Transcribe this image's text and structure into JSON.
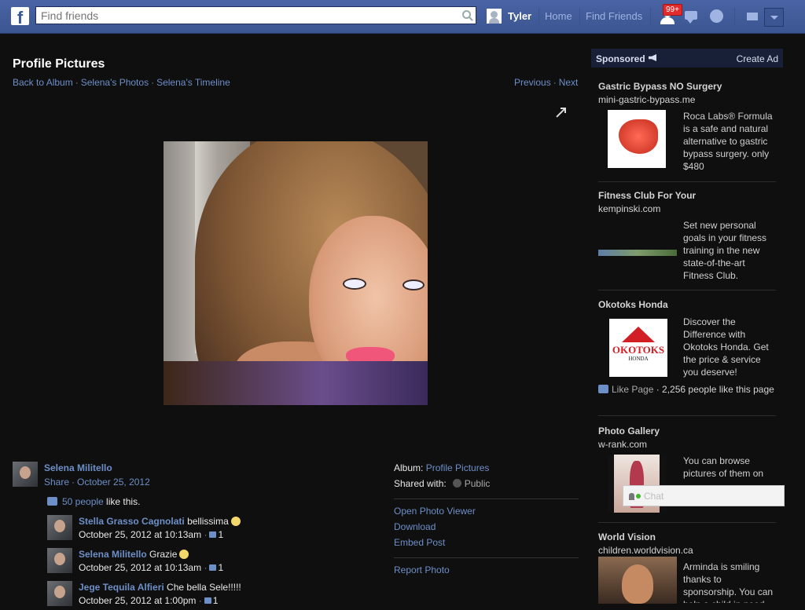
{
  "topbar": {
    "logo": "f",
    "search_placeholder": "Find friends",
    "user_name": "Tyler",
    "home": "Home",
    "find_friends": "Find Friends",
    "friend_requests_badge": "99+",
    "icons": [
      "search-icon",
      "friend-requests-icon",
      "messages-icon",
      "notifications-globe-icon",
      "privacy-shortcuts-icon",
      "account-menu-arrow-icon"
    ]
  },
  "page": {
    "title": "Profile Pictures",
    "breadcrumbs": [
      "Back to Album",
      "Selena's Photos",
      "Selena's Timeline"
    ],
    "previous": "Previous",
    "next": "Next"
  },
  "owner": {
    "name": "Selena Militello",
    "share": "Share",
    "date": "October 25, 2012"
  },
  "likes": {
    "count_link": "50 people",
    "suffix": " like this."
  },
  "comments": [
    {
      "name": "Stella Grasso Cagnolati",
      "text": "bellissima",
      "smiley": true,
      "time": "October 25, 2012 at 10:13am",
      "likes": "1"
    },
    {
      "name": "Selena Militello",
      "text": "Grazie",
      "smiley": true,
      "time": "October 25, 2012 at 10:13am",
      "likes": "1"
    },
    {
      "name": "Jege Tequila Alfieri",
      "text": "Che bella Sele!!!!!",
      "smiley": false,
      "time": "October 25, 2012 at 1:00pm",
      "likes": "1"
    }
  ],
  "details": {
    "album_label": "Album:",
    "album_value": "Profile Pictures",
    "shared_label": "Shared with:",
    "shared_value": "Public",
    "actions": [
      "Open Photo Viewer",
      "Download",
      "Embed Post"
    ],
    "report": "Report Photo"
  },
  "sidebar": {
    "sponsored": "Sponsored",
    "create_ad": "Create Ad",
    "ads": [
      {
        "title": "Gastric Bypass NO Surgery",
        "domain": "mini-gastric-bypass.me",
        "text": "Roca Labs® Formula is a safe and natural alternative to gastric bypass surgery. only $480"
      },
      {
        "title": "Fitness Club For Your",
        "domain": "kempinski.com",
        "text": "Set new personal goals in your fitness training in the new state-of-the-art Fitness Club."
      },
      {
        "title": "Okotoks Honda",
        "domain": "",
        "text": "Discover the Difference with Okotoks Honda. Get the price & service you deserve!",
        "logo_text": "OKOTOKS",
        "logo_sub": "HONDA",
        "like_page": "Like Page",
        "like_count": "2,256 people like this page"
      },
      {
        "title": "Photo Gallery",
        "domain": "w-rank.com",
        "text": "You can browse pictures of them on our gallery"
      },
      {
        "title": "World Vision",
        "domain": "children.worldvision.ca",
        "text": "Arminda is smiling thanks to sponsorship. You can help a child in need"
      }
    ]
  },
  "chat": {
    "label": "Chat"
  }
}
